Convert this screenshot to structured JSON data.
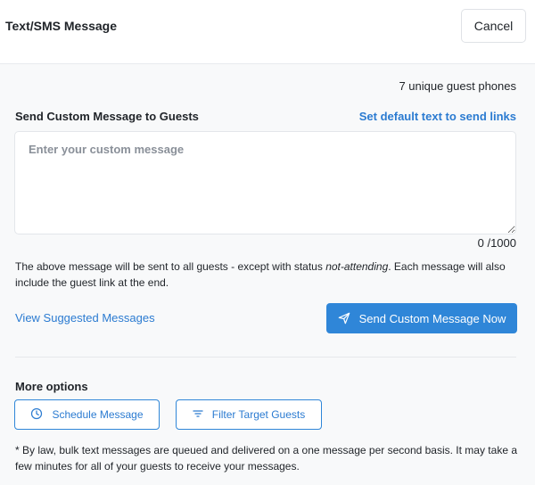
{
  "header": {
    "title": "Text/SMS Message",
    "cancel_label": "Cancel"
  },
  "summary": {
    "phones_text": "7 unique guest phones"
  },
  "custom_message": {
    "label": "Send Custom Message to Guests",
    "default_link": "Set default text to send links",
    "placeholder": "Enter your custom message",
    "value": "",
    "counter": "0 /1000"
  },
  "notice": {
    "before": "The above message will be sent to all guests - except with status ",
    "status": "not-attending",
    "after": ". Each message will also include the guest link at the end."
  },
  "actions": {
    "suggested_link": "View Suggested Messages",
    "send_label": "Send Custom Message Now",
    "send_icon": "paper-plane-icon"
  },
  "more_options": {
    "label": "More options",
    "schedule_label": "Schedule Message",
    "schedule_icon": "clock-icon",
    "filter_label": "Filter Target Guests",
    "filter_icon": "filter-icon"
  },
  "footnote": "* By law, bulk text messages are queued and delivered on a one message per second basis. It may take a few minutes for all of your guests to receive your messages.",
  "colors": {
    "accent": "#2f86d8",
    "link": "#2b7bd1",
    "panel_bg": "#f8f9fa"
  }
}
